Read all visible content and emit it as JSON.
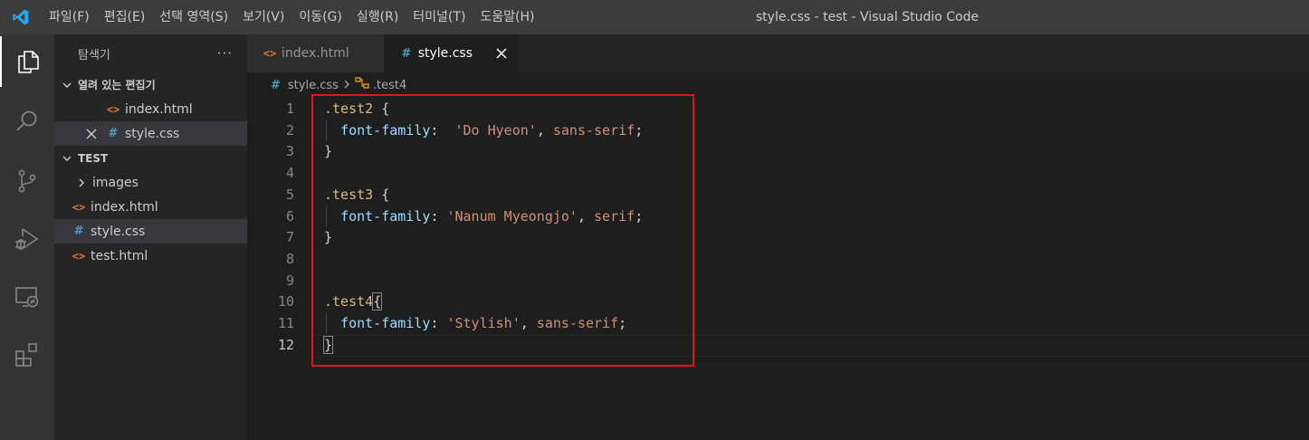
{
  "window": {
    "title": "style.css - test - Visual Studio Code"
  },
  "menu": [
    "파일(F)",
    "편집(E)",
    "선택 영역(S)",
    "보기(V)",
    "이동(G)",
    "실행(R)",
    "터미널(T)",
    "도움말(H)"
  ],
  "activity_bar": [
    "files-icon",
    "search-icon",
    "source-control-icon",
    "run-debug-icon",
    "remote-explorer-icon",
    "extensions-icon"
  ],
  "sidebar": {
    "title": "탐색기",
    "more": "···",
    "open_editors_label": "열려 있는 편집기",
    "open_editors": [
      {
        "name": "index.html",
        "type": "html"
      },
      {
        "name": "style.css",
        "type": "css"
      }
    ],
    "project_label": "TEST",
    "files": [
      {
        "name": "images",
        "type": "folder"
      },
      {
        "name": "index.html",
        "type": "html"
      },
      {
        "name": "style.css",
        "type": "css"
      },
      {
        "name": "test.html",
        "type": "html"
      }
    ]
  },
  "tabs": [
    {
      "label": "index.html",
      "icon": "<>"
    },
    {
      "label": "style.css",
      "icon": "#"
    }
  ],
  "breadcrumb": {
    "file": "style.css",
    "symbol": ".test4",
    "file_icon": "#"
  },
  "editor": {
    "line_numbers": [
      "1",
      "2",
      "3",
      "4",
      "5",
      "6",
      "7",
      "8",
      "9",
      "10",
      "11",
      "12"
    ],
    "current_line": "12",
    "lines": [
      {
        "t": [
          [
            ".test2",
            "sel"
          ],
          [
            " {",
            "p"
          ]
        ]
      },
      {
        "t": [
          [
            "  ",
            "p"
          ],
          [
            "font-family",
            "prop"
          ],
          [
            ":  ",
            "p"
          ],
          [
            "'Do Hyeon'",
            "str"
          ],
          [
            ", ",
            "p"
          ],
          [
            "sans-serif",
            "val"
          ],
          [
            ";",
            "p"
          ]
        ]
      },
      {
        "t": [
          [
            "}",
            "p"
          ]
        ]
      },
      {
        "t": []
      },
      {
        "t": [
          [
            ".test3",
            "sel"
          ],
          [
            " {",
            "p"
          ]
        ]
      },
      {
        "t": [
          [
            "  ",
            "p"
          ],
          [
            "font-family",
            "prop"
          ],
          [
            ": ",
            "p"
          ],
          [
            "'Nanum Myeongjo'",
            "str"
          ],
          [
            ", ",
            "p"
          ],
          [
            "serif",
            "val"
          ],
          [
            ";",
            "p"
          ]
        ]
      },
      {
        "t": [
          [
            "}",
            "p"
          ]
        ]
      },
      {
        "t": []
      },
      {
        "t": []
      },
      {
        "t": [
          [
            ".test4",
            "sel"
          ],
          [
            "{",
            "bm"
          ]
        ]
      },
      {
        "t": [
          [
            "  ",
            "p"
          ],
          [
            "font-family",
            "prop"
          ],
          [
            ": ",
            "p"
          ],
          [
            "'Stylish'",
            "str"
          ],
          [
            ", ",
            "p"
          ],
          [
            "sans-serif",
            "val"
          ],
          [
            ";",
            "p"
          ]
        ]
      },
      {
        "t": [
          [
            "}",
            "bm"
          ]
        ]
      }
    ]
  },
  "colors": {
    "highlight_box": "#e81123",
    "accent": "#007acc"
  }
}
